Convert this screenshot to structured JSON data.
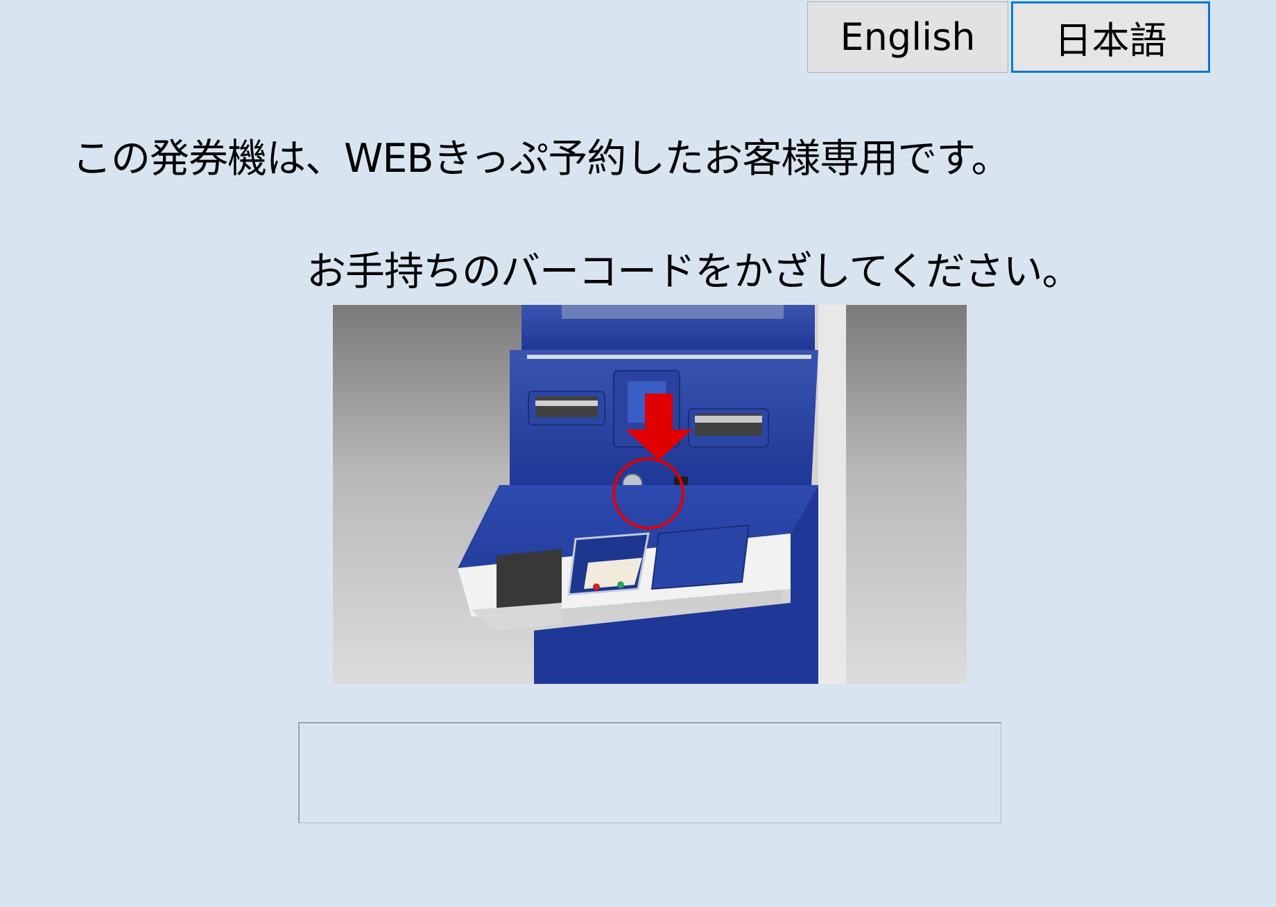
{
  "language_switch": {
    "english_label": "English",
    "japanese_label": "日本語",
    "selected": "日本語"
  },
  "messages": {
    "line1": "この発券機は、WEBきっぷ予約したお客様専用です。",
    "line2": "お手持ちのバーコードをかざしてください。"
  },
  "illustration": {
    "subject": "ticket-machine-barcode-reader",
    "highlight_color": "#e00000"
  },
  "barcode_input": {
    "value": ""
  }
}
